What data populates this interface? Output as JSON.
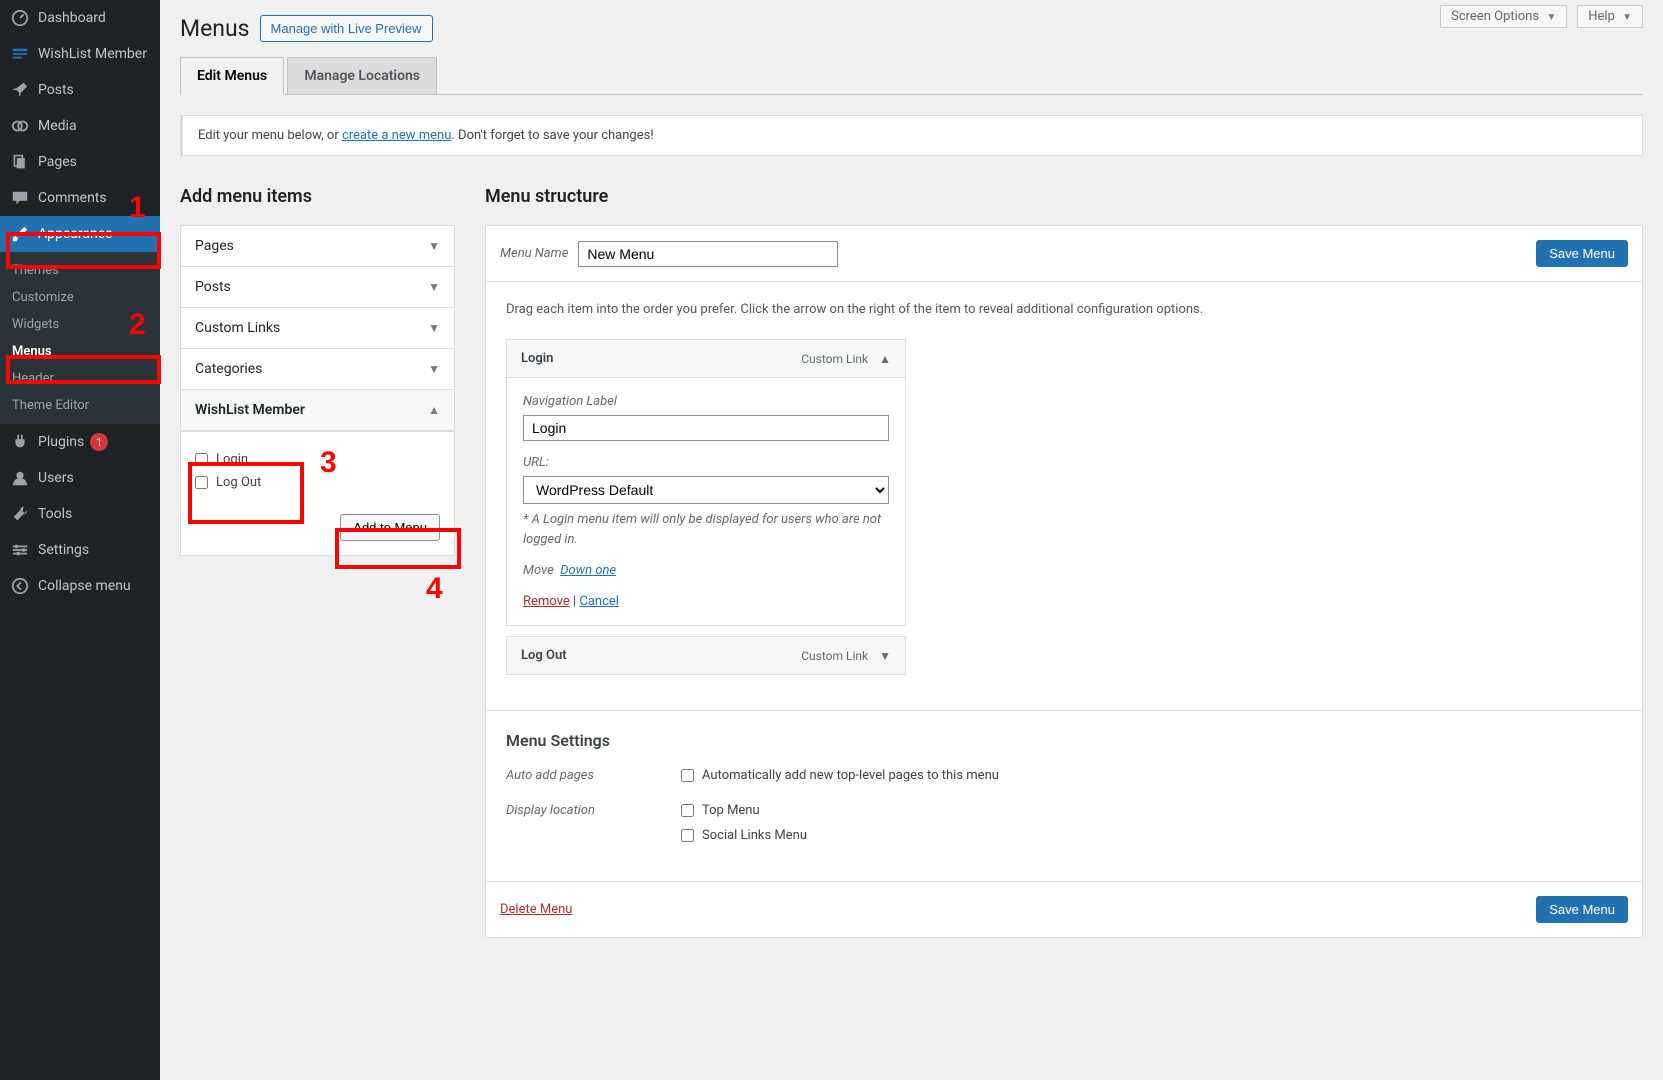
{
  "top_buttons": {
    "screen_options": "Screen Options",
    "help": "Help"
  },
  "sidebar": {
    "items": [
      {
        "label": "Dashboard"
      },
      {
        "label": "WishList Member"
      },
      {
        "label": "Posts"
      },
      {
        "label": "Media"
      },
      {
        "label": "Pages"
      },
      {
        "label": "Comments"
      },
      {
        "label": "Appearance"
      },
      {
        "label": "Plugins",
        "badge": "1"
      },
      {
        "label": "Users"
      },
      {
        "label": "Tools"
      },
      {
        "label": "Settings"
      },
      {
        "label": "Collapse menu"
      }
    ],
    "appearance_sub": [
      "Themes",
      "Customize",
      "Widgets",
      "Menus",
      "Header",
      "Theme Editor"
    ]
  },
  "header": {
    "title": "Menus",
    "button": "Manage with Live Preview"
  },
  "tabs": [
    {
      "label": "Edit Menus",
      "active": true
    },
    {
      "label": "Manage Locations",
      "active": false
    }
  ],
  "notice": {
    "pre": "Edit your menu below, or ",
    "link": "create a new menu",
    "post": ". Don't forget to save your changes!"
  },
  "left_col": {
    "heading": "Add menu items",
    "sections": [
      {
        "label": "Pages",
        "open": false
      },
      {
        "label": "Posts",
        "open": false
      },
      {
        "label": "Custom Links",
        "open": false
      },
      {
        "label": "Categories",
        "open": false
      },
      {
        "label": "WishList Member",
        "open": true
      }
    ],
    "wlm_items": [
      "Login",
      "Log Out"
    ],
    "add_button": "Add to Menu"
  },
  "right_col": {
    "heading": "Menu structure",
    "menu_name_label": "Menu Name",
    "menu_name_value": "New Menu",
    "save_button": "Save Menu",
    "instructions": "Drag each item into the order you prefer. Click the arrow on the right of the item to reveal additional configuration options.",
    "items": [
      {
        "title": "Login",
        "type": "Custom Link",
        "open": true,
        "nav_label_caption": "Navigation Label",
        "nav_label_value": "Login",
        "url_caption": "URL:",
        "url_value": "WordPress Default",
        "note": "* A Login menu item will only be displayed for users who are not logged in.",
        "move_label": "Move",
        "move_link": "Down one",
        "remove": "Remove",
        "cancel": "Cancel",
        "sep": " | "
      },
      {
        "title": "Log Out",
        "type": "Custom Link",
        "open": false
      }
    ],
    "settings": {
      "heading": "Menu Settings",
      "auto_add_label": "Auto add pages",
      "auto_add_option": "Automatically add new top-level pages to this menu",
      "display_loc_label": "Display location",
      "display_loc_options": [
        "Top Menu",
        "Social Links Menu"
      ]
    },
    "footer": {
      "delete": "Delete Menu",
      "save": "Save Menu"
    }
  },
  "annotations": {
    "n1": "1",
    "n2": "2",
    "n3": "3",
    "n4": "4"
  }
}
